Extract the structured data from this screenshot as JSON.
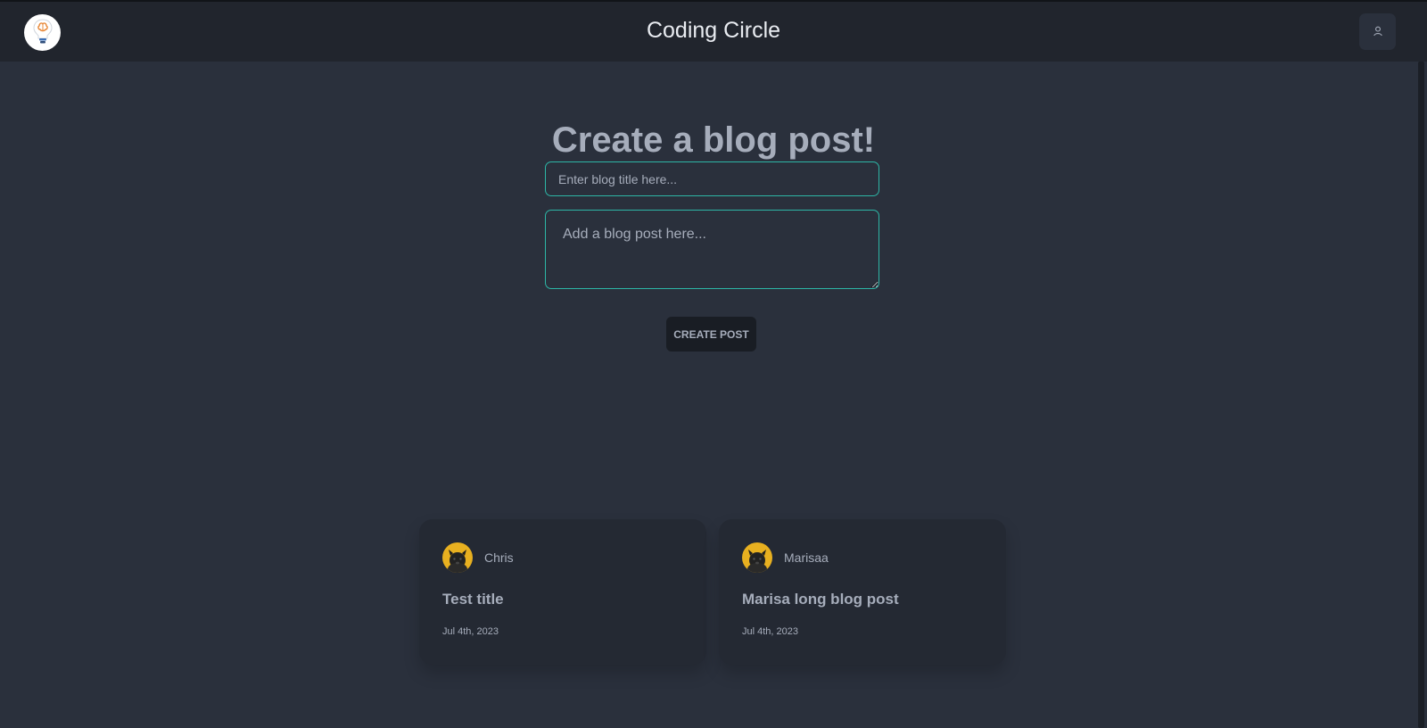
{
  "app": {
    "title": "Coding Circle"
  },
  "icons": {
    "logo": "lightbulb-brain-icon",
    "user": "user-icon",
    "avatar": "dog-avatar-icon"
  },
  "colors": {
    "background": "#2a303c",
    "navbar": "#21252d",
    "accent_border": "#2db6a6",
    "card": "#242933",
    "button": "#191d24",
    "text": "#a6adbb",
    "avatar_bg": "#e8b020"
  },
  "page": {
    "heading": "Create a blog post!"
  },
  "form": {
    "title_placeholder": "Enter blog title here...",
    "body_placeholder": "Add a blog post here...",
    "submit_label": "CREATE POST"
  },
  "posts": [
    {
      "author": "Chris",
      "title": "Test title",
      "date": "Jul 4th, 2023"
    },
    {
      "author": "Marisaa",
      "title": "Marisa long blog post",
      "date": "Jul 4th, 2023"
    }
  ]
}
